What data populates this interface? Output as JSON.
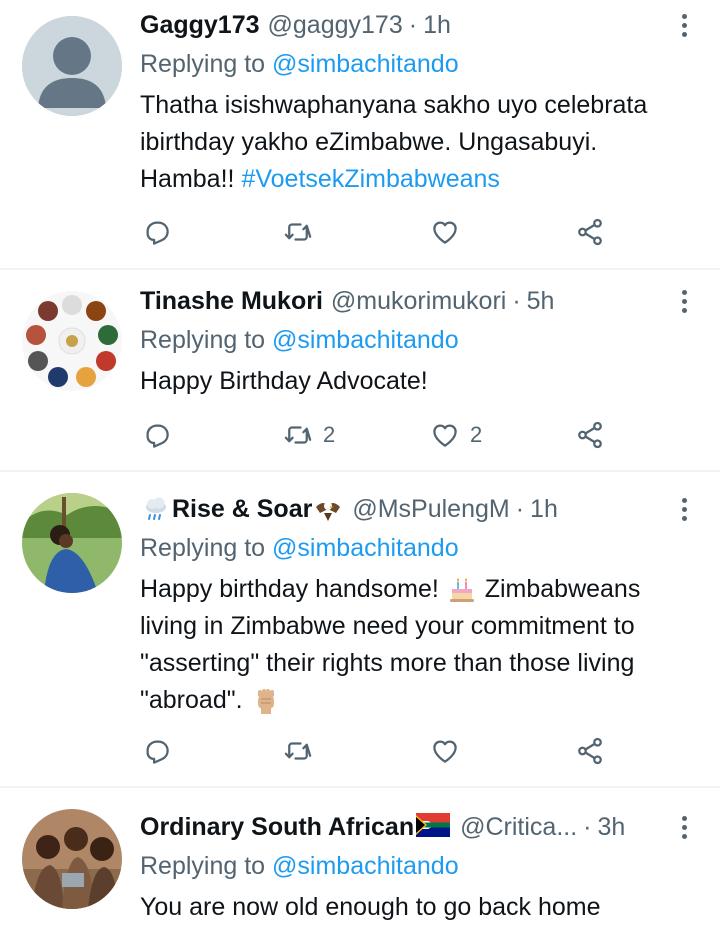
{
  "tweets": [
    {
      "name": "Gaggy173",
      "handle": "@gaggy173",
      "time": "1h",
      "replying_prefix": "Replying to",
      "replying_to": "@simbachitando",
      "body_lines": [
        "Thatha isishwaphanyana sakho uyo celebrata",
        "ibirthday yakho eZimbabwe. Ungasabuyi.",
        "Hamba!!"
      ],
      "hashtag": "#VoetsekZimbabweans",
      "retweets": "",
      "likes": ""
    },
    {
      "name": "Tinashe Mukori",
      "handle": "@mukorimukori",
      "time": "5h",
      "replying_prefix": "Replying to",
      "replying_to": "@simbachitando",
      "body_lines": [
        "Happy Birthday Advocate!"
      ],
      "retweets": "2",
      "likes": "2"
    },
    {
      "name": "Rise & Soar",
      "handle": "@MsPulengM",
      "time": "1h",
      "replying_prefix": "Replying to",
      "replying_to": "@simbachitando",
      "body_lines": [
        "Happy birthday handsome!",
        "Zimbabweans",
        "living in Zimbabwe need your commitment to",
        "\"asserting\" their rights more than those living",
        "\"abroad\"."
      ],
      "retweets": "",
      "likes": ""
    },
    {
      "name": "Ordinary South African",
      "handle": "@Critica...",
      "time": "3h",
      "replying_prefix": "Replying to",
      "replying_to": "@simbachitando",
      "body_lines": [
        "You are now old enough to go back home"
      ]
    }
  ],
  "separator": "·",
  "icons": {
    "reply": "reply-icon",
    "retweet": "retweet-icon",
    "like": "heart-icon",
    "share": "share-icon",
    "more": "more-vertical-icon"
  },
  "colors": {
    "name": "#0f1419",
    "secondary": "#536471",
    "link": "#1d9bf0",
    "divider": "#eff3f4"
  }
}
